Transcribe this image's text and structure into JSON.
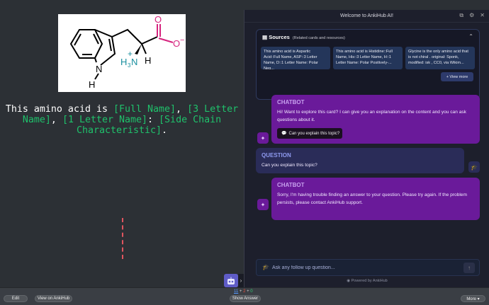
{
  "card": {
    "prefix": "This amino acid is ",
    "cloze1": "[Full Name]",
    "sep1": ", ",
    "cloze2": "[3 Letter Name]",
    "sep2": ", ",
    "cloze3": "[1 Letter Name]",
    "sep3": ": ",
    "cloze4": "[Side Chain Characteristic]",
    "suffix": ".",
    "molecule_labels": {
      "n": "N",
      "h_ring": "H",
      "carbonyl_o": "O",
      "carboxyl_o": "O",
      "minus": "−",
      "plus": "+",
      "h3": "H",
      "h3_sub": "3",
      "n_amine": "N",
      "alpha_h": "H"
    }
  },
  "panel": {
    "title": "Welcome to AnkiHub AI!",
    "sources": {
      "title": "Sources",
      "subtitle": "(Related cards and resources)",
      "cards": [
        "This amino acid is Aspartic Acid::Full Name, ASP::3 Letter Name, D::1 Letter Name: Polar Neg...",
        "This amino acid is Histidine::Full Name, His::3 Letter Name, H::1 Letter Name: Polar Positively-...",
        "Glycine is the only amino acid that is not chiral . original: Sponk, modified: isk , CC0, via Wikim..."
      ],
      "view_more": "+ View more"
    },
    "messages": [
      {
        "role": "CHATBOT",
        "text": "Hi! Want to explore this card? I can give you an explanation on the content and you can ask questions about it.",
        "button": "Can you explain this topic?"
      },
      {
        "role": "QUESTION",
        "text": "Can you explain this topic?"
      },
      {
        "role": "CHATBOT",
        "text": "Sorry, I'm having trouble finding an answer to your question. Please try again. If the problem persists, please contact AnkiHub support."
      }
    ],
    "input_placeholder": "Ask any follow up question...",
    "powered_by": "Powered by AnkiHub"
  },
  "bottom": {
    "edit": "Edit",
    "view_on_ankihub": "View on AnkiHub",
    "count_new": "11",
    "count_learn": "2",
    "count_review": "0",
    "plus": "+",
    "show_answer": "Show Answer",
    "more": "More ▾"
  },
  "colors": {
    "cloze": "#1fc16b",
    "chatbot_bg": "#6a1a9a",
    "question_bg": "#2a2c58",
    "molecule_accent": "#d6247e",
    "amine_color": "#1a8f9f"
  },
  "icons": [
    "external-link-icon",
    "gear-icon",
    "close-icon",
    "document-icon",
    "chevron-up-icon",
    "sparkle-icon",
    "graduation-cap-icon",
    "chat-icon",
    "send-icon",
    "robot-icon",
    "chevron-right-icon",
    "ankihub-logo-icon"
  ]
}
